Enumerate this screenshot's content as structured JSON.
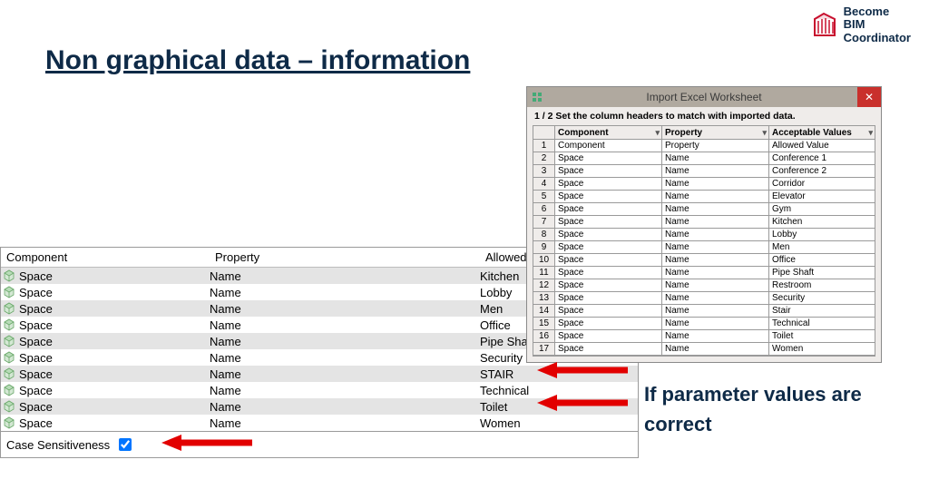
{
  "logo": {
    "line1": "Become",
    "line2": "BIM",
    "line3": "Coordinator"
  },
  "title": "Non graphical data – information",
  "left_table": {
    "headers": {
      "component": "Component",
      "property": "Property",
      "value": "Allowed Value"
    },
    "rows": [
      {
        "component": "Space",
        "property": "Name",
        "value": "Kitchen"
      },
      {
        "component": "Space",
        "property": "Name",
        "value": "Lobby"
      },
      {
        "component": "Space",
        "property": "Name",
        "value": "Men"
      },
      {
        "component": "Space",
        "property": "Name",
        "value": "Office"
      },
      {
        "component": "Space",
        "property": "Name",
        "value": "Pipe Shaft"
      },
      {
        "component": "Space",
        "property": "Name",
        "value": "Security"
      },
      {
        "component": "Space",
        "property": "Name",
        "value": "STAIR"
      },
      {
        "component": "Space",
        "property": "Name",
        "value": "Technical"
      },
      {
        "component": "Space",
        "property": "Name",
        "value": "Toilet"
      },
      {
        "component": "Space",
        "property": "Name",
        "value": "Women"
      }
    ],
    "case_label": "Case Sensitiveness",
    "case_checked": true
  },
  "dialog": {
    "title": "Import Excel Worksheet",
    "instruction": "1 / 2 Set the column headers to match with imported data.",
    "headers": {
      "a": "Component",
      "b": "Property",
      "c": "Acceptable Values"
    },
    "rows": [
      {
        "n": "1",
        "a": "Component",
        "b": "Property",
        "c": "Allowed Value"
      },
      {
        "n": "2",
        "a": "Space",
        "b": "Name",
        "c": "Conference 1"
      },
      {
        "n": "3",
        "a": "Space",
        "b": "Name",
        "c": "Conference 2"
      },
      {
        "n": "4",
        "a": "Space",
        "b": "Name",
        "c": "Corridor"
      },
      {
        "n": "5",
        "a": "Space",
        "b": "Name",
        "c": "Elevator"
      },
      {
        "n": "6",
        "a": "Space",
        "b": "Name",
        "c": "Gym"
      },
      {
        "n": "7",
        "a": "Space",
        "b": "Name",
        "c": "Kitchen"
      },
      {
        "n": "8",
        "a": "Space",
        "b": "Name",
        "c": "Lobby"
      },
      {
        "n": "9",
        "a": "Space",
        "b": "Name",
        "c": "Men"
      },
      {
        "n": "10",
        "a": "Space",
        "b": "Name",
        "c": "Office"
      },
      {
        "n": "11",
        "a": "Space",
        "b": "Name",
        "c": "Pipe Shaft"
      },
      {
        "n": "12",
        "a": "Space",
        "b": "Name",
        "c": "Restroom"
      },
      {
        "n": "13",
        "a": "Space",
        "b": "Name",
        "c": "Security"
      },
      {
        "n": "14",
        "a": "Space",
        "b": "Name",
        "c": "Stair"
      },
      {
        "n": "15",
        "a": "Space",
        "b": "Name",
        "c": "Technical"
      },
      {
        "n": "16",
        "a": "Space",
        "b": "Name",
        "c": "Toilet"
      },
      {
        "n": "17",
        "a": "Space",
        "b": "Name",
        "c": "Women"
      }
    ]
  },
  "param_text": "If parameter values are correct"
}
